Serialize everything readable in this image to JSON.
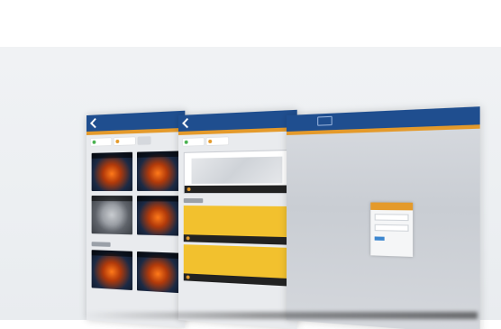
{
  "scene": {
    "description_colors": {
      "top_bar": "#1f4e8f",
      "accent": "#e49a2b",
      "alert_yellow": "#f2c12e",
      "status_green": "#48b14e",
      "login_button": "#3b86cf"
    },
    "screens": [
      {
        "icon": "back-arrow-icon"
      },
      {
        "icon": "back-arrow-icon"
      },
      {
        "icon": "brand-logo"
      }
    ]
  }
}
